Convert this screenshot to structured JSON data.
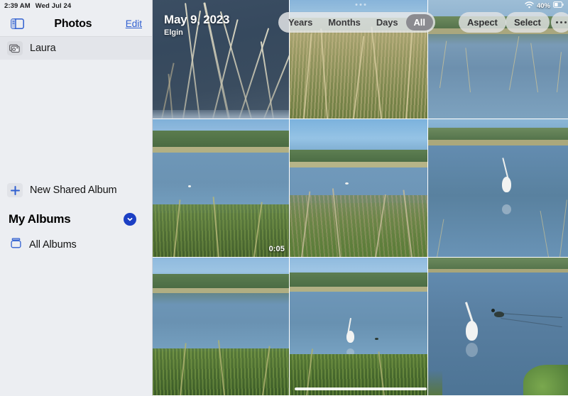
{
  "status_bar": {
    "time": "2:39 AM",
    "date": "Wed Jul 24",
    "battery": "40%",
    "wifi_icon": "wifi-icon",
    "battery_icon": "battery-icon"
  },
  "sidebar": {
    "toggle_icon": "sidebar-toggle-icon",
    "title": "Photos",
    "edit_label": "Edit",
    "shared_items": [
      {
        "label": "Laura",
        "icon": "shared-album-icon",
        "selected": true
      }
    ],
    "new_shared_album": {
      "label": "New Shared Album",
      "icon": "plus-icon"
    },
    "group": {
      "title": "My Albums",
      "chevron_icon": "chevron-down-icon",
      "chevron_color": "#1b3fc4"
    },
    "albums": [
      {
        "label": "All Albums",
        "icon": "albums-icon"
      }
    ]
  },
  "toolbar": {
    "segments": [
      {
        "label": "Years",
        "active": false
      },
      {
        "label": "Months",
        "active": false
      },
      {
        "label": "Days",
        "active": false
      },
      {
        "label": "All",
        "active": true
      }
    ],
    "aspect_label": "Aspect",
    "select_label": "Select",
    "more_icon": "more-ellipsis-icon",
    "grabber_icon": "grabber-dots-icon"
  },
  "overlay": {
    "date": "May 9, 2023",
    "location": "Elgin"
  },
  "photo_grid": {
    "columns": 3,
    "rows": 3,
    "cells": [
      {
        "id": "p1",
        "alt": "Reeds on dark blue pond water",
        "duration": null
      },
      {
        "id": "p2",
        "alt": "Tall dry grasses along lake shore with blue sky",
        "duration": null
      },
      {
        "id": "p3",
        "alt": "Calm lake with reflected treeline and grass tufts",
        "duration": null
      },
      {
        "id": "p4",
        "alt": "Pond with treeline and reed-filled bank, bird on water",
        "duration": "0:05"
      },
      {
        "id": "p5",
        "alt": "Wide lake view with green bank and distant trees",
        "duration": null
      },
      {
        "id": "p6",
        "alt": "Blue lake with white egret wading near shore",
        "duration": null
      },
      {
        "id": "p7",
        "alt": "Lake shore with reeds and reflection of trees",
        "duration": null
      },
      {
        "id": "p8",
        "alt": "White egret standing in shallow lake water",
        "duration": null
      },
      {
        "id": "p9",
        "alt": "White egret and a duck swimming on blue water",
        "duration": null
      }
    ]
  },
  "home_indicator": "home-indicator"
}
